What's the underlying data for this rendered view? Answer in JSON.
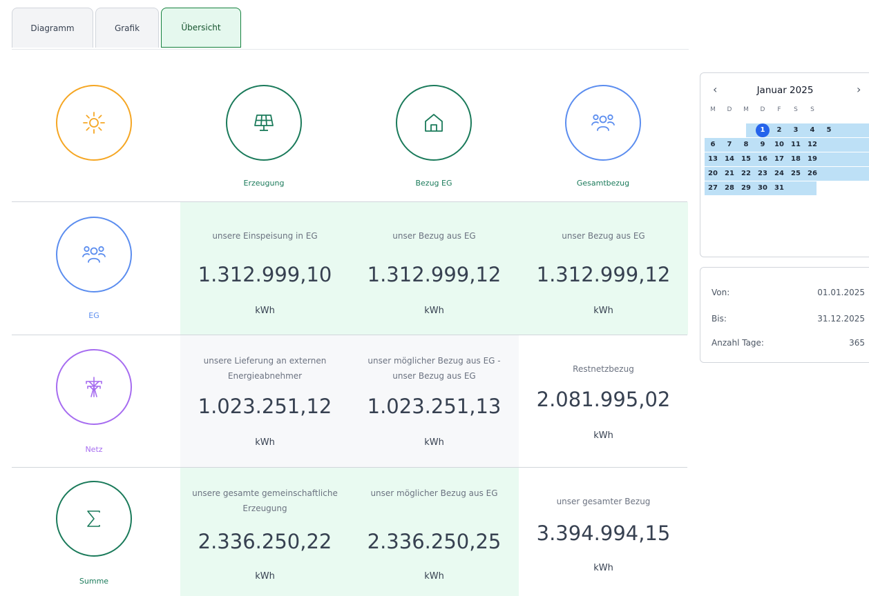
{
  "tabs": [
    {
      "label": "Diagramm"
    },
    {
      "label": "Grafik"
    },
    {
      "label": "Übersicht"
    }
  ],
  "headers": {
    "sun_icon": "sun-icon",
    "erzeugung": {
      "label": "Erzeugung",
      "icon": "solar-panel-icon"
    },
    "bezug_eg": {
      "label": "Bezug EG",
      "icon": "house-icon"
    },
    "gesamtbezug": {
      "label": "Gesamtbezug",
      "icon": "group-icon"
    }
  },
  "rows": [
    {
      "label": "EG",
      "icon": "group-icon",
      "cells": [
        {
          "desc": "unsere Einspeisung in EG",
          "value": "1.312.999,10",
          "unit": "kWh"
        },
        {
          "desc": "unser Bezug aus EG",
          "value": "1.312.999,12",
          "unit": "kWh"
        },
        {
          "desc": "unser Bezug aus EG",
          "value": "1.312.999,12",
          "unit": "kWh"
        }
      ]
    },
    {
      "label": "Netz",
      "icon": "power-pylon-icon",
      "cells": [
        {
          "desc": "unsere Lieferung an externen Energieabnehmer",
          "value": "1.023.251,12",
          "unit": "kWh"
        },
        {
          "desc": "unser möglicher Bezug aus EG - unser Bezug aus EG",
          "value": "1.023.251,13",
          "unit": "kWh"
        },
        {
          "desc": "Restnetzbezug",
          "value": "2.081.995,02",
          "unit": "kWh"
        }
      ]
    },
    {
      "label": "Summe",
      "icon": "sigma-icon",
      "cells": [
        {
          "desc": "unsere gesamte gemeinschaftliche Erzeugung",
          "value": "2.336.250,22",
          "unit": "kWh"
        },
        {
          "desc": "unser möglicher Bezug aus EG",
          "value": "2.336.250,25",
          "unit": "kWh"
        },
        {
          "desc": "unser gesamter Bezug",
          "value": "3.394.994,15",
          "unit": "kWh"
        }
      ]
    }
  ],
  "calendar": {
    "title": "Januar 2025",
    "prev": "‹",
    "next": "›",
    "weekdays": [
      "M",
      "D",
      "M",
      "D",
      "F",
      "S",
      "S"
    ],
    "days": [
      "1",
      "2",
      "3",
      "4",
      "5",
      "6",
      "7",
      "8",
      "9",
      "10",
      "11",
      "12",
      "13",
      "14",
      "15",
      "16",
      "17",
      "18",
      "19",
      "20",
      "21",
      "22",
      "23",
      "24",
      "25",
      "26",
      "27",
      "28",
      "29",
      "30",
      "31"
    ],
    "today": "1"
  },
  "period": {
    "von_label": "Von:",
    "von_value": "01.01.2025",
    "bis_label": "Bis:",
    "bis_value": "31.12.2025",
    "tage_label": "Anzahl Tage:",
    "tage_value": "365"
  },
  "colors": {
    "sun": "#f5a623",
    "green": "#1a7a5a",
    "blue": "#5b8def",
    "purple": "#a66cf0",
    "highlight": "#e9faf1",
    "muted": "#f7f8fa",
    "calendar_range": "#bde0f6",
    "calendar_today": "#2563eb"
  }
}
